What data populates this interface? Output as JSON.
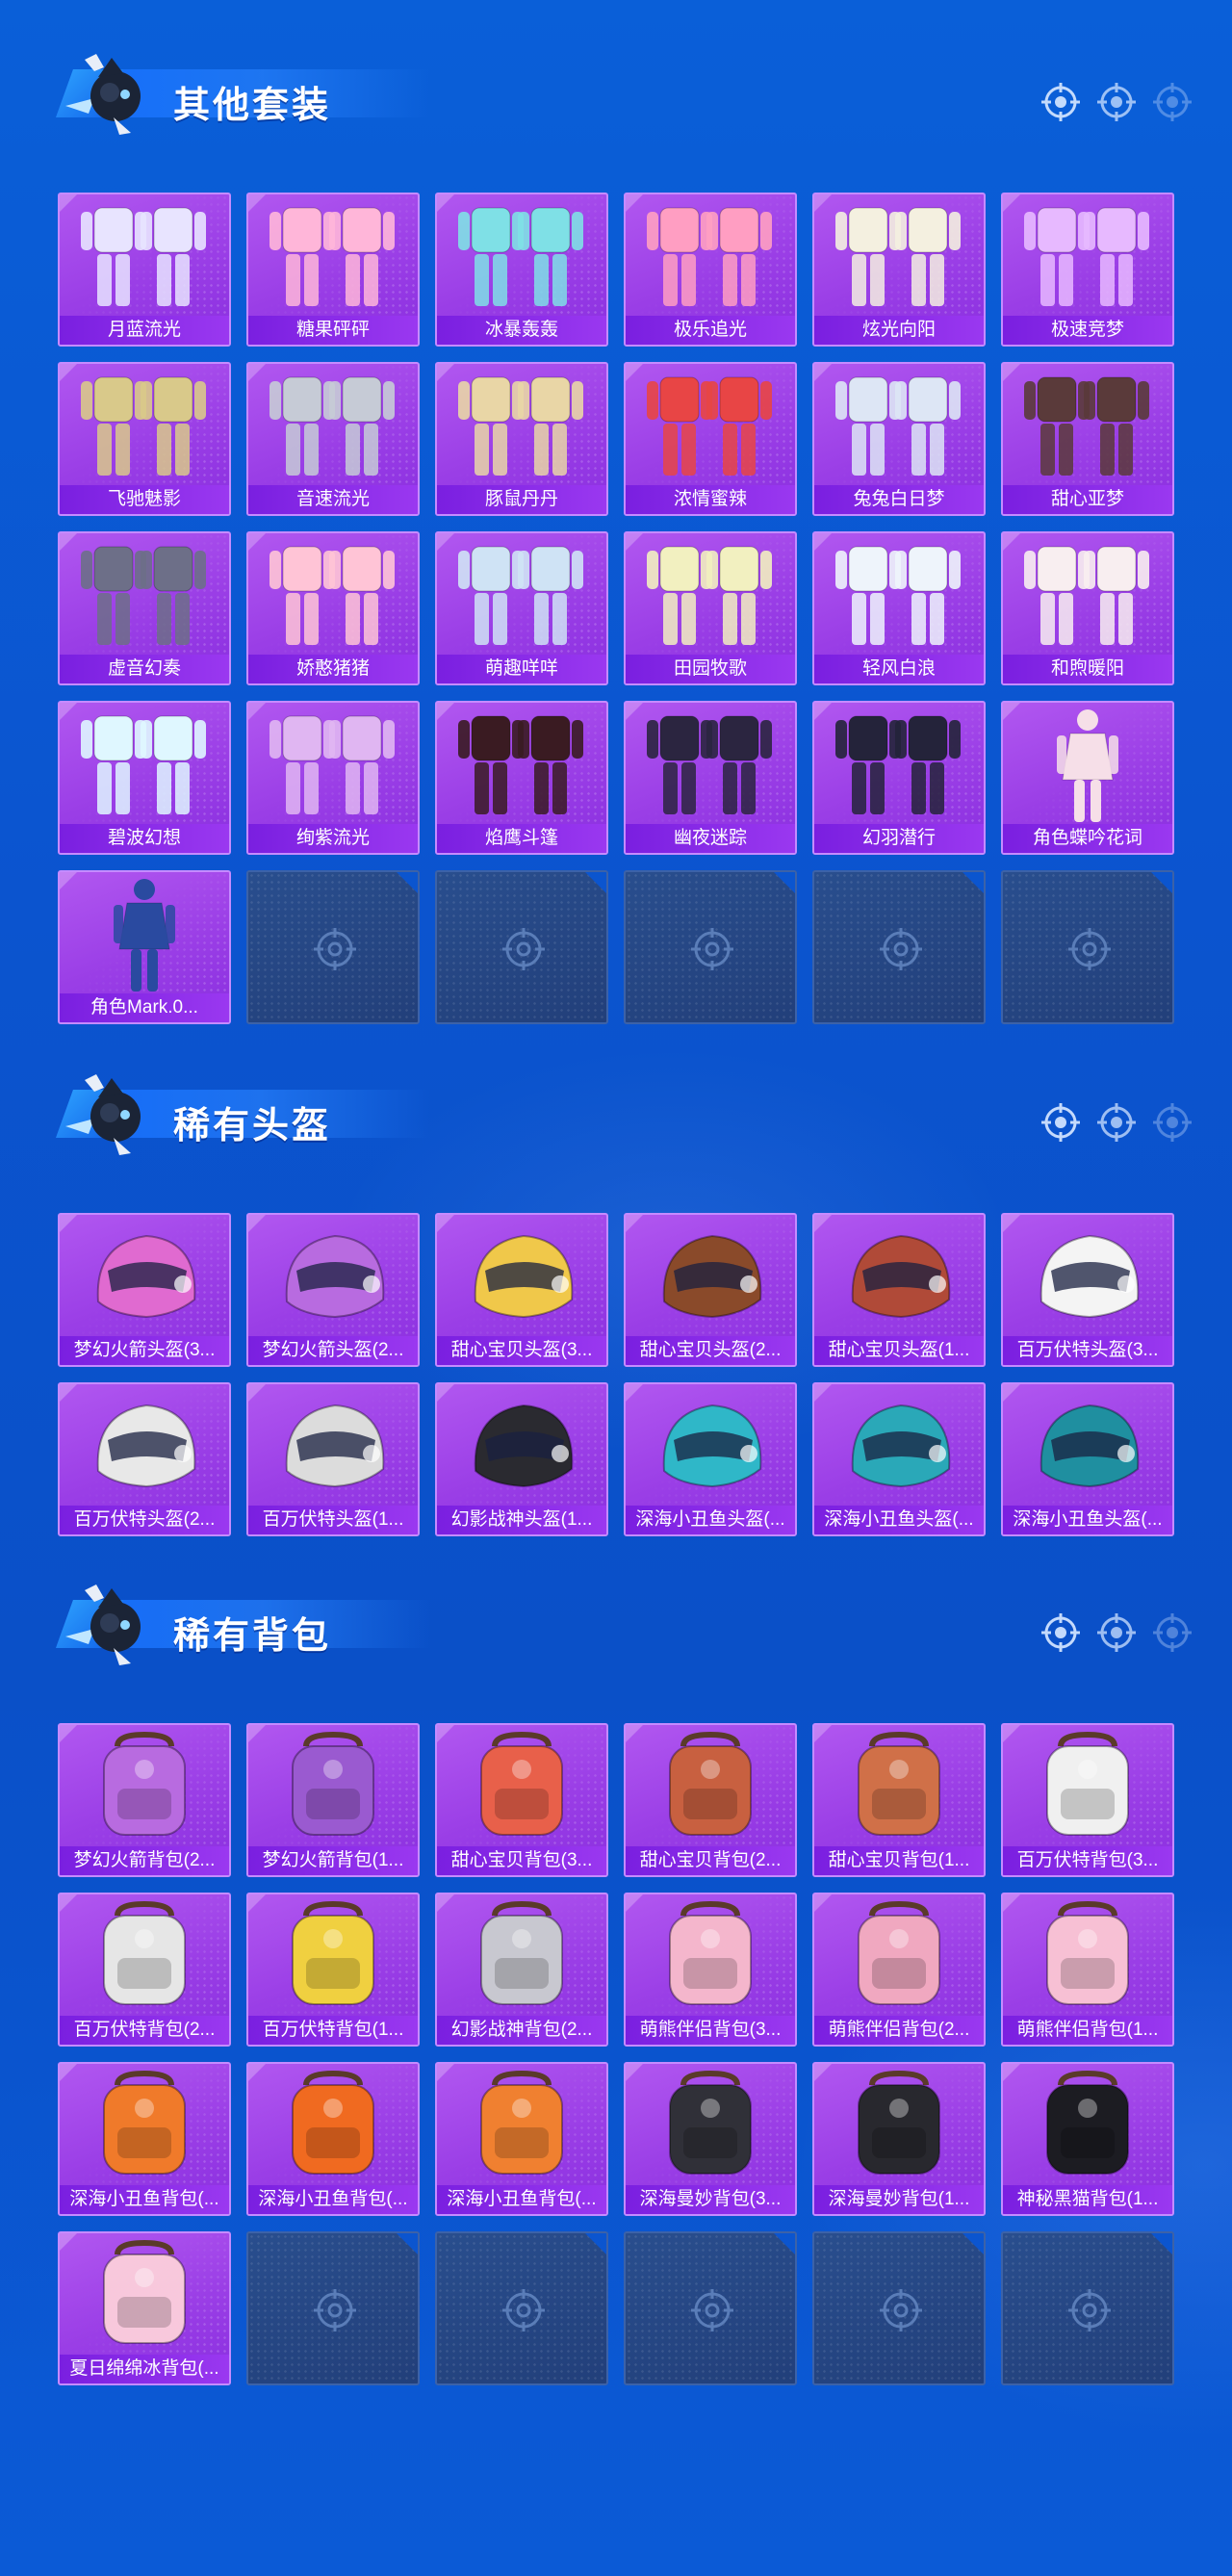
{
  "sections": [
    {
      "title": "其他套装",
      "items": [
        {
          "label": "月蓝流光",
          "icon": "outfit-icon",
          "tone": "#e8e4ff"
        },
        {
          "label": "糖果砰砰",
          "icon": "outfit-icon",
          "tone": "#ffb6d9"
        },
        {
          "label": "冰暴轰轰",
          "icon": "outfit-icon",
          "tone": "#7fe0e6"
        },
        {
          "label": "极乐追光",
          "icon": "outfit-icon",
          "tone": "#ff9ec2"
        },
        {
          "label": "炫光向阳",
          "icon": "outfit-icon",
          "tone": "#f4f0e0"
        },
        {
          "label": "极速竞梦",
          "icon": "outfit-icon",
          "tone": "#e7b9ff"
        },
        {
          "label": "飞驰魅影",
          "icon": "outfit-icon",
          "tone": "#d9c98a"
        },
        {
          "label": "音速流光",
          "icon": "outfit-icon",
          "tone": "#c6cbd6"
        },
        {
          "label": "豚鼠丹丹",
          "icon": "outfit-icon",
          "tone": "#e9d6a6"
        },
        {
          "label": "浓情蜜辣",
          "icon": "outfit-icon",
          "tone": "#e84545"
        },
        {
          "label": "兔兔白日梦",
          "icon": "outfit-icon",
          "tone": "#dde6f5"
        },
        {
          "label": "甜心亚梦",
          "icon": "outfit-icon",
          "tone": "#5a3a3a"
        },
        {
          "label": "虚音幻奏",
          "icon": "outfit-icon",
          "tone": "#6d6f88"
        },
        {
          "label": "娇憨猪猪",
          "icon": "outfit-icon",
          "tone": "#ffc4d6"
        },
        {
          "label": "萌趣咩咩",
          "icon": "outfit-icon",
          "tone": "#cfe3f5"
        },
        {
          "label": "田园牧歌",
          "icon": "outfit-icon",
          "tone": "#f2f0c0"
        },
        {
          "label": "轻风白浪",
          "icon": "outfit-icon",
          "tone": "#eef4fb"
        },
        {
          "label": "和煦暖阳",
          "icon": "outfit-icon",
          "tone": "#f8eef0"
        },
        {
          "label": "碧波幻想",
          "icon": "outfit-icon",
          "tone": "#dff7ff"
        },
        {
          "label": "绚紫流光",
          "icon": "outfit-icon",
          "tone": "#e0b6f2"
        },
        {
          "label": "焰鹰斗篷",
          "icon": "outfit-icon",
          "tone": "#3a1b22"
        },
        {
          "label": "幽夜迷踪",
          "icon": "outfit-icon",
          "tone": "#2b2540"
        },
        {
          "label": "幻羽潜行",
          "icon": "outfit-icon",
          "tone": "#24233a"
        },
        {
          "label": "角色蝶吟花词",
          "icon": "character-icon",
          "tone": "#f6dfe8"
        },
        {
          "label": "角色Mark.0...",
          "icon": "character-icon",
          "tone": "#2a4aa0"
        }
      ],
      "empty_count": 5
    },
    {
      "title": "稀有头盔",
      "items": [
        {
          "label": "梦幻火箭头盔(3...",
          "icon": "helmet-icon",
          "tone": "#e06ad0"
        },
        {
          "label": "梦幻火箭头盔(2...",
          "icon": "helmet-icon",
          "tone": "#b86be0"
        },
        {
          "label": "甜心宝贝头盔(3...",
          "icon": "helmet-icon",
          "tone": "#f0c84a"
        },
        {
          "label": "甜心宝贝头盔(2...",
          "icon": "helmet-icon",
          "tone": "#8a4a2a"
        },
        {
          "label": "甜心宝贝头盔(1...",
          "icon": "helmet-icon",
          "tone": "#b04a38"
        },
        {
          "label": "百万伏特头盔(3...",
          "icon": "helmet-icon",
          "tone": "#f4f4f4"
        },
        {
          "label": "百万伏特头盔(2...",
          "icon": "helmet-icon",
          "tone": "#e8e8e8"
        },
        {
          "label": "百万伏特头盔(1...",
          "icon": "helmet-icon",
          "tone": "#dcdcdc"
        },
        {
          "label": "幻影战神头盔(1...",
          "icon": "helmet-icon",
          "tone": "#2a2a30"
        },
        {
          "label": "深海小丑鱼头盔(...",
          "icon": "helmet-icon",
          "tone": "#2fb7c8"
        },
        {
          "label": "深海小丑鱼头盔(...",
          "icon": "helmet-icon",
          "tone": "#2aa8b8"
        },
        {
          "label": "深海小丑鱼头盔(...",
          "icon": "helmet-icon",
          "tone": "#1f8fa0"
        }
      ],
      "empty_count": 0
    },
    {
      "title": "稀有背包",
      "items": [
        {
          "label": "梦幻火箭背包(2...",
          "icon": "backpack-icon",
          "tone": "#b86be0"
        },
        {
          "label": "梦幻火箭背包(1...",
          "icon": "backpack-icon",
          "tone": "#9a5ad0"
        },
        {
          "label": "甜心宝贝背包(3...",
          "icon": "backpack-icon",
          "tone": "#e8604a"
        },
        {
          "label": "甜心宝贝背包(2...",
          "icon": "backpack-icon",
          "tone": "#c86040"
        },
        {
          "label": "甜心宝贝背包(1...",
          "icon": "backpack-icon",
          "tone": "#d07048"
        },
        {
          "label": "百万伏特背包(3...",
          "icon": "backpack-icon",
          "tone": "#f0f0f0"
        },
        {
          "label": "百万伏特背包(2...",
          "icon": "backpack-icon",
          "tone": "#e6e6e6"
        },
        {
          "label": "百万伏特背包(1...",
          "icon": "backpack-icon",
          "tone": "#f0d040"
        },
        {
          "label": "幻影战神背包(2...",
          "icon": "backpack-icon",
          "tone": "#c8c8d0"
        },
        {
          "label": "萌熊伴侣背包(3...",
          "icon": "backpack-icon",
          "tone": "#f4b6cc"
        },
        {
          "label": "萌熊伴侣背包(2...",
          "icon": "backpack-icon",
          "tone": "#f0a8c0"
        },
        {
          "label": "萌熊伴侣背包(1...",
          "icon": "backpack-icon",
          "tone": "#f7c0d4"
        },
        {
          "label": "深海小丑鱼背包(...",
          "icon": "backpack-icon",
          "tone": "#f07a2a"
        },
        {
          "label": "深海小丑鱼背包(...",
          "icon": "backpack-icon",
          "tone": "#f06a20"
        },
        {
          "label": "深海小丑鱼背包(...",
          "icon": "backpack-icon",
          "tone": "#f08030"
        },
        {
          "label": "深海曼妙背包(3...",
          "icon": "backpack-icon",
          "tone": "#303038"
        },
        {
          "label": "深海曼妙背包(1...",
          "icon": "backpack-icon",
          "tone": "#28282e"
        },
        {
          "label": "神秘黑猫背包(1...",
          "icon": "backpack-icon",
          "tone": "#1c1c22"
        },
        {
          "label": "夏日绵绵冰背包(...",
          "icon": "backpack-icon",
          "tone": "#f8c8dc"
        }
      ],
      "empty_count": 5
    }
  ],
  "colors": {
    "card_purple": "#9a3ee6",
    "label_bar": "#7a1fe0",
    "empty_card": "#294e8e",
    "background": "#0b54cf"
  }
}
